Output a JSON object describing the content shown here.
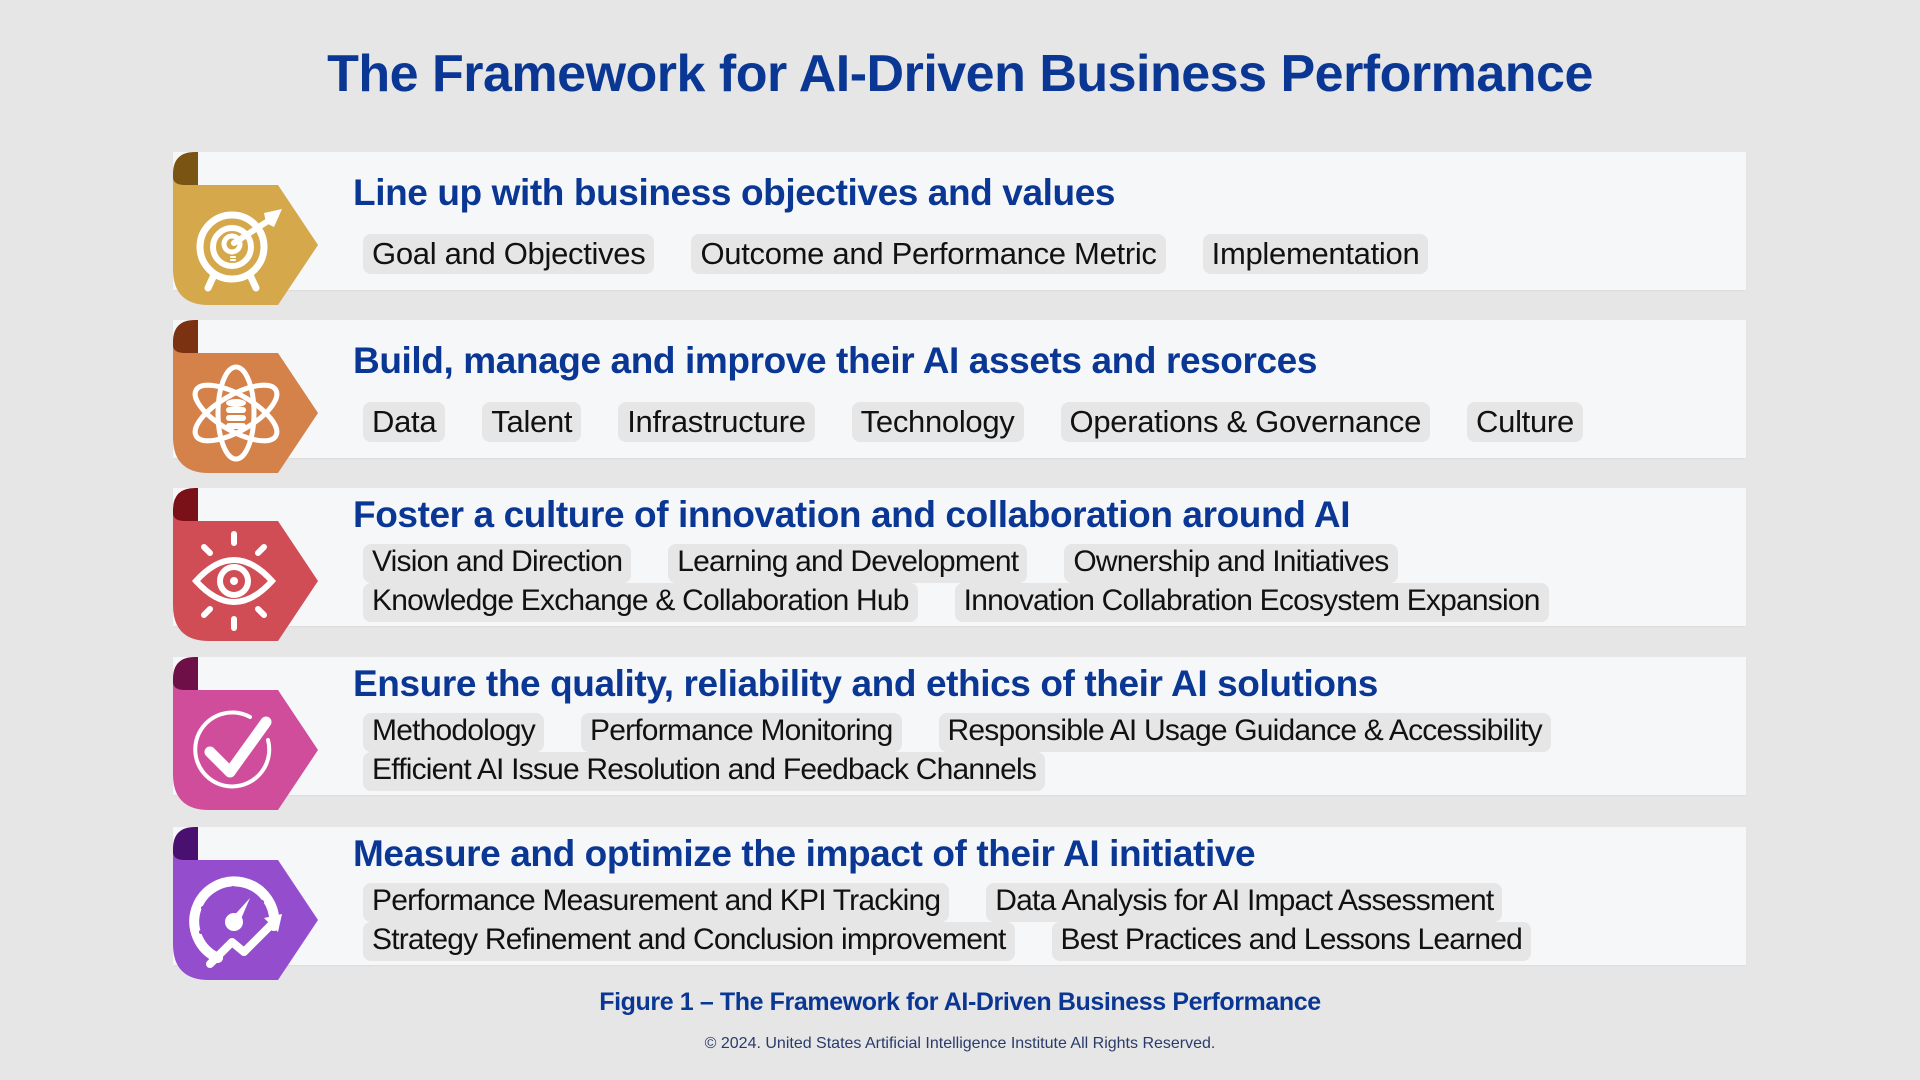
{
  "title": "The Framework for AI-Driven Business Performance",
  "colors": {
    "title_blue": "#0a3694",
    "background": "#e6e6e6",
    "card": "#f6f7f9",
    "pill": "#e6e6e6"
  },
  "sections": [
    {
      "heading": "Line up with business objectives and values",
      "icon": "target-arrow-bulb-icon",
      "color": "#d4a84b",
      "curl_color": "#7a5412",
      "pills": [
        [
          "Goal and Objectives",
          "Outcome and Performance Metric",
          "Implementation"
        ]
      ]
    },
    {
      "heading": "Build, manage and improve their AI assets and resorces",
      "icon": "atom-database-icon",
      "color": "#d4814a",
      "curl_color": "#7a3210",
      "pills": [
        [
          "Data",
          "Talent",
          "Infrastructure",
          "Technology",
          "Operations & Governance",
          "Culture"
        ]
      ]
    },
    {
      "heading": "Foster a culture of innovation and collaboration around AI",
      "icon": "eye-vision-icon",
      "color": "#d04d55",
      "curl_color": "#7a1018",
      "pills": [
        [
          "Vision and Direction",
          "Learning and Development",
          "Ownership and Initiatives"
        ],
        [
          "Knowledge Exchange & Collaboration Hub",
          "Innovation Collabration Ecosystem Expansion"
        ]
      ]
    },
    {
      "heading": "Ensure the quality, reliability and ethics of their AI solutions",
      "icon": "check-circle-icon",
      "color": "#d04d9c",
      "curl_color": "#6e0f48",
      "pills": [
        [
          "Methodology",
          "Performance Monitoring",
          "Responsible AI Usage Guidance & Accessibility"
        ],
        [
          "Efficient AI Issue Resolution and Feedback Channels"
        ]
      ]
    },
    {
      "heading": "Measure and optimize the impact of their AI initiative",
      "icon": "gauge-growth-icon",
      "color": "#944dcc",
      "curl_color": "#4a1070",
      "pills": [
        [
          "Performance Measurement and KPI Tracking",
          "Data Analysis for AI Impact Assessment"
        ],
        [
          "Strategy Refinement and Conclusion improvement",
          "Best Practices and Lessons Learned"
        ]
      ]
    }
  ],
  "caption": "Figure 1 – The Framework for AI-Driven Business Performance",
  "copyright": "© 2024. United States Artificial Intelligence Institute All Rights Reserved."
}
